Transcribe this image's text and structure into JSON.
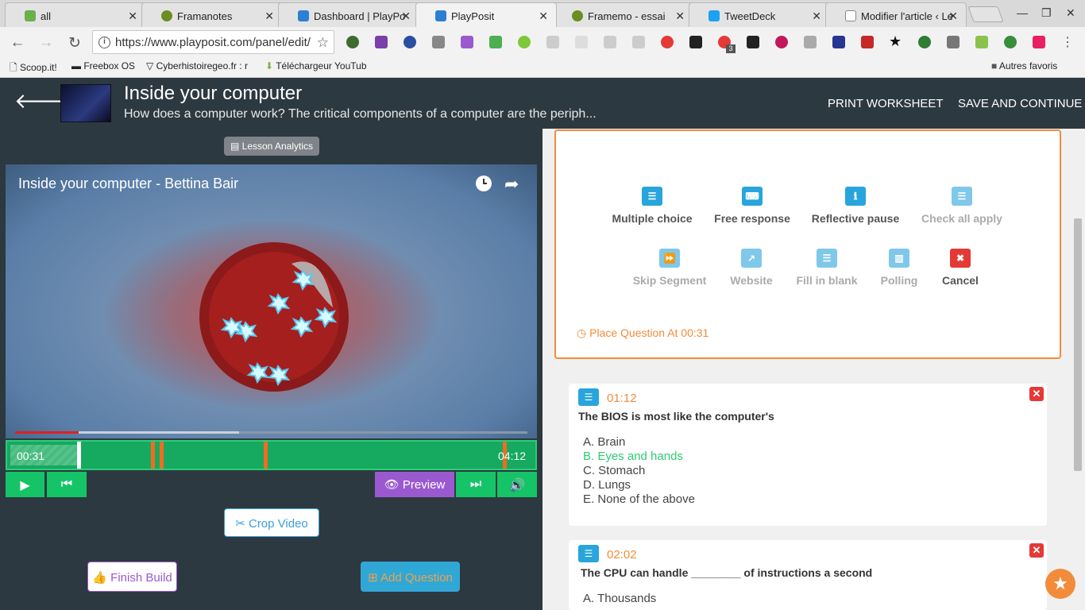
{
  "browser": {
    "tabs": [
      {
        "label": "all",
        "fav": "#6ab04c"
      },
      {
        "label": "Framanotes",
        "fav": "#6b8e23"
      },
      {
        "label": "Dashboard | PlayPo",
        "fav": "#2d7fd3"
      },
      {
        "label": "PlayPosit",
        "fav": "#2d7fd3"
      },
      {
        "label": "Framemo - essai",
        "fav": "#6b8e23"
      },
      {
        "label": "TweetDeck",
        "fav": "#1da1f2"
      },
      {
        "label": "Modifier l'article ‹ Le",
        "fav": "#888888"
      }
    ],
    "url": "https://www.playposit.com/panel/edit/",
    "bookmarks": [
      "Scoop.it!",
      "Freebox OS",
      "Cyberhistoiregeo.fr : r",
      "Téléchargeur YouTub",
      "Autres favoris"
    ],
    "notification_badge": "3"
  },
  "header": {
    "title": "Inside your computer",
    "subtitle": "How does a computer work? The critical components of a computer are the periph...",
    "print_label": "PRINT WORKSHEET",
    "save_label": "SAVE AND CONTINUE"
  },
  "left": {
    "analytics_label": "Lesson Analytics",
    "video_title": "Inside your computer - Bettina Bair",
    "time_current": "00:31",
    "time_total": "04:12",
    "preview_label": "Preview",
    "crop_label": "Crop Video",
    "finish_label": "Finish Build",
    "add_question_label": "Add Question"
  },
  "picker": {
    "types": [
      {
        "label": "Multiple choice",
        "icon": "list-icon",
        "color": "#27a5dc",
        "enabled": true
      },
      {
        "label": "Free response",
        "icon": "keyboard-icon",
        "color": "#27a5dc",
        "enabled": true
      },
      {
        "label": "Reflective pause",
        "icon": "info-icon",
        "color": "#27a5dc",
        "enabled": true
      },
      {
        "label": "Check all apply",
        "icon": "checklist-icon",
        "color": "#7fc8ea",
        "enabled": false
      },
      {
        "label": "Skip Segment",
        "icon": "fast-forward-icon",
        "color": "#7fc8ea",
        "enabled": false
      },
      {
        "label": "Website",
        "icon": "external-link-icon",
        "color": "#7fc8ea",
        "enabled": false
      },
      {
        "label": "Fill in blank",
        "icon": "fill-blank-icon",
        "color": "#7fc8ea",
        "enabled": false
      },
      {
        "label": "Polling",
        "icon": "bar-chart-icon",
        "color": "#7fc8ea",
        "enabled": false
      },
      {
        "label": "Cancel",
        "icon": "close-icon",
        "color": "#e53935",
        "enabled": true
      }
    ],
    "place_label": "Place Question At 00:31"
  },
  "questions": [
    {
      "time": "01:12",
      "text": "The BIOS is most like the computer's",
      "options": [
        "A. Brain",
        "B. Eyes and hands",
        "C. Stomach",
        "D. Lungs",
        "E. None of the above"
      ],
      "correct_index": 1
    },
    {
      "time": "02:02",
      "text": "The CPU can handle ________ of instructions a second",
      "options": [
        "A. Thousands"
      ],
      "correct_index": -1
    }
  ],
  "colors": {
    "accent": "#f28c3a",
    "correct": "#2ecc71",
    "brand_dark": "#2d3940"
  }
}
